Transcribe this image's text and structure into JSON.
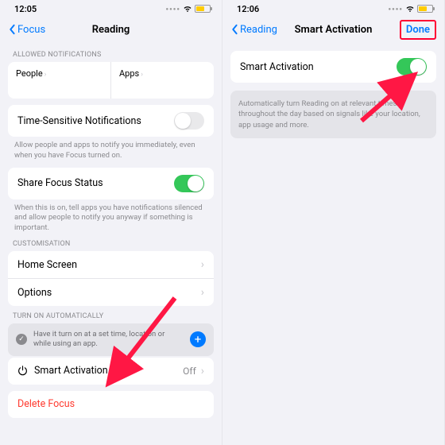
{
  "left": {
    "status": {
      "time": "12:05"
    },
    "nav": {
      "back": "Focus",
      "title": "Reading"
    },
    "sections": {
      "allowed_header": "ALLOWED NOTIFICATIONS",
      "people": "People",
      "apps": "Apps",
      "time_sensitive": "Time-Sensitive Notifications",
      "time_sensitive_footer": "Allow people and apps to notify you immediately, even when you have Focus turned on.",
      "share_status": "Share Focus Status",
      "share_status_footer": "When this is on, tell apps you have notifications silenced and allow people to notify you anyway if something is important.",
      "customisation_header": "CUSTOMISATION",
      "home_screen": "Home Screen",
      "options": "Options",
      "auto_header": "TURN ON AUTOMATICALLY",
      "auto_hint": "Have it turn on at a set time, location or while using an app.",
      "smart_activation": "Smart Activation",
      "smart_activation_value": "Off",
      "delete": "Delete Focus"
    }
  },
  "right": {
    "status": {
      "time": "12:06"
    },
    "nav": {
      "back": "Reading",
      "title": "Smart Activation",
      "done": "Done"
    },
    "smart_activation": "Smart Activation",
    "description": "Automatically turn Reading on at relevant times throughout the day based on signals like your location, app usage and more."
  }
}
